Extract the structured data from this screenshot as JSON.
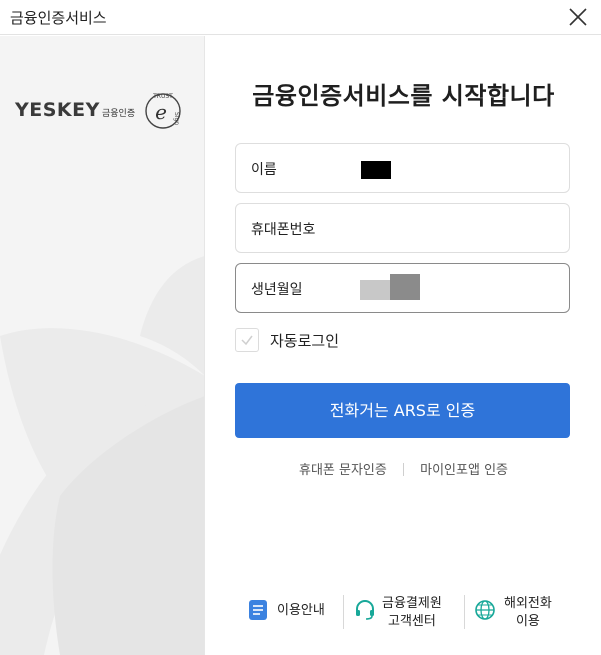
{
  "window": {
    "title": "금융인증서비스"
  },
  "brand": {
    "name": "YESKEY",
    "subtitle": "금융인증",
    "badge_top": "TRUST",
    "badge_letter": "e",
    "badge_side": "Sign"
  },
  "main": {
    "heading": "금융인증서비스를 시작합니다",
    "fields": [
      {
        "label": "이름",
        "value": "",
        "masked": true
      },
      {
        "label": "휴대폰번호",
        "value": ""
      },
      {
        "label": "생년월일",
        "value": "",
        "masked": true
      }
    ],
    "auto_login": {
      "label": "자동로그인",
      "checked": false
    },
    "primary_button": "전화거는 ARS로 인증",
    "alt_links": [
      "휴대폰 문자인증",
      "마이인포앱 인증"
    ]
  },
  "footer": {
    "items": [
      {
        "label": "이용안내",
        "icon": "document-icon"
      },
      {
        "label": "금융결제원\n고객센터",
        "icon": "headset-icon"
      },
      {
        "label": "해외전화\n이용",
        "icon": "globe-icon"
      }
    ]
  },
  "colors": {
    "primary": "#2f74d9",
    "left_panel": "#f4f4f4"
  }
}
